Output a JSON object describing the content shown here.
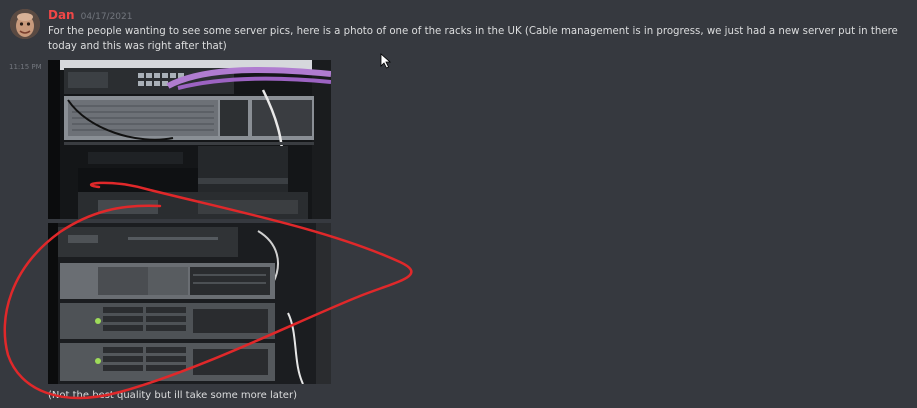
{
  "message": {
    "username": "Dan",
    "date": "04/17/2021",
    "text": "For the people wanting to see some server pics, here is a photo of one of the racks in the UK (Cable management is in progress, we just had a new server put in there today and this was right after that)",
    "hover_timestamp": "11:15 PM",
    "caption": "(Not the best quality but ill take some more later)",
    "username_color": "#f04747"
  },
  "icons": {
    "avatar": "avatar",
    "cursor": "mouse-cursor-icon"
  },
  "photos": {
    "top_alt": "server rack photo top",
    "bottom_alt": "server rack photo bottom",
    "annotation_color": "#e0282a"
  }
}
